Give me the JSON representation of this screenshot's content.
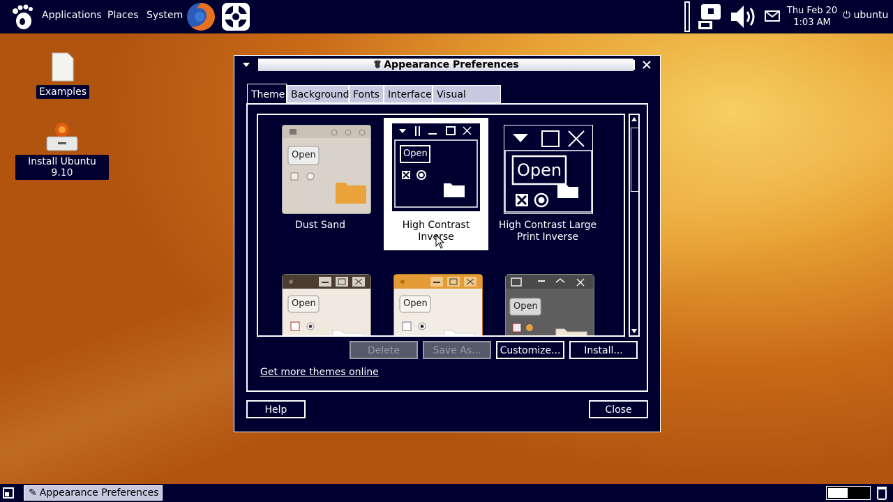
{
  "top_panel": {
    "menus": [
      "Applications",
      "Places",
      "System"
    ],
    "clock_day": "Thu Feb 20",
    "clock_time": "1:03 AM",
    "user": "ubuntu"
  },
  "desktop": {
    "icons": [
      {
        "label": "Examples"
      },
      {
        "label": "Install Ubuntu 9.10"
      }
    ]
  },
  "window": {
    "title": "Appearance Preferences",
    "tabs": [
      "Theme",
      "Background",
      "Fonts",
      "Interface",
      "Visual Effects"
    ],
    "active_tab": "Theme",
    "themes": [
      {
        "name": "Dust Sand"
      },
      {
        "name": "High Contrast Inverse",
        "selected": true
      },
      {
        "name": "High Contrast Large Print Inverse"
      }
    ],
    "thumb_text": "Open",
    "buttons": {
      "delete": "Delete",
      "save_as": "Save As...",
      "customize": "Customize...",
      "install": "Install...",
      "help": "Help",
      "close": "Close"
    },
    "link": "Get more themes online"
  },
  "bottom_panel": {
    "task": "Appearance Preferences"
  },
  "colors": {
    "panel_bg": "#000030",
    "tab_inactive": "#c8c8e0",
    "desktop_accent": "#e8a335"
  }
}
